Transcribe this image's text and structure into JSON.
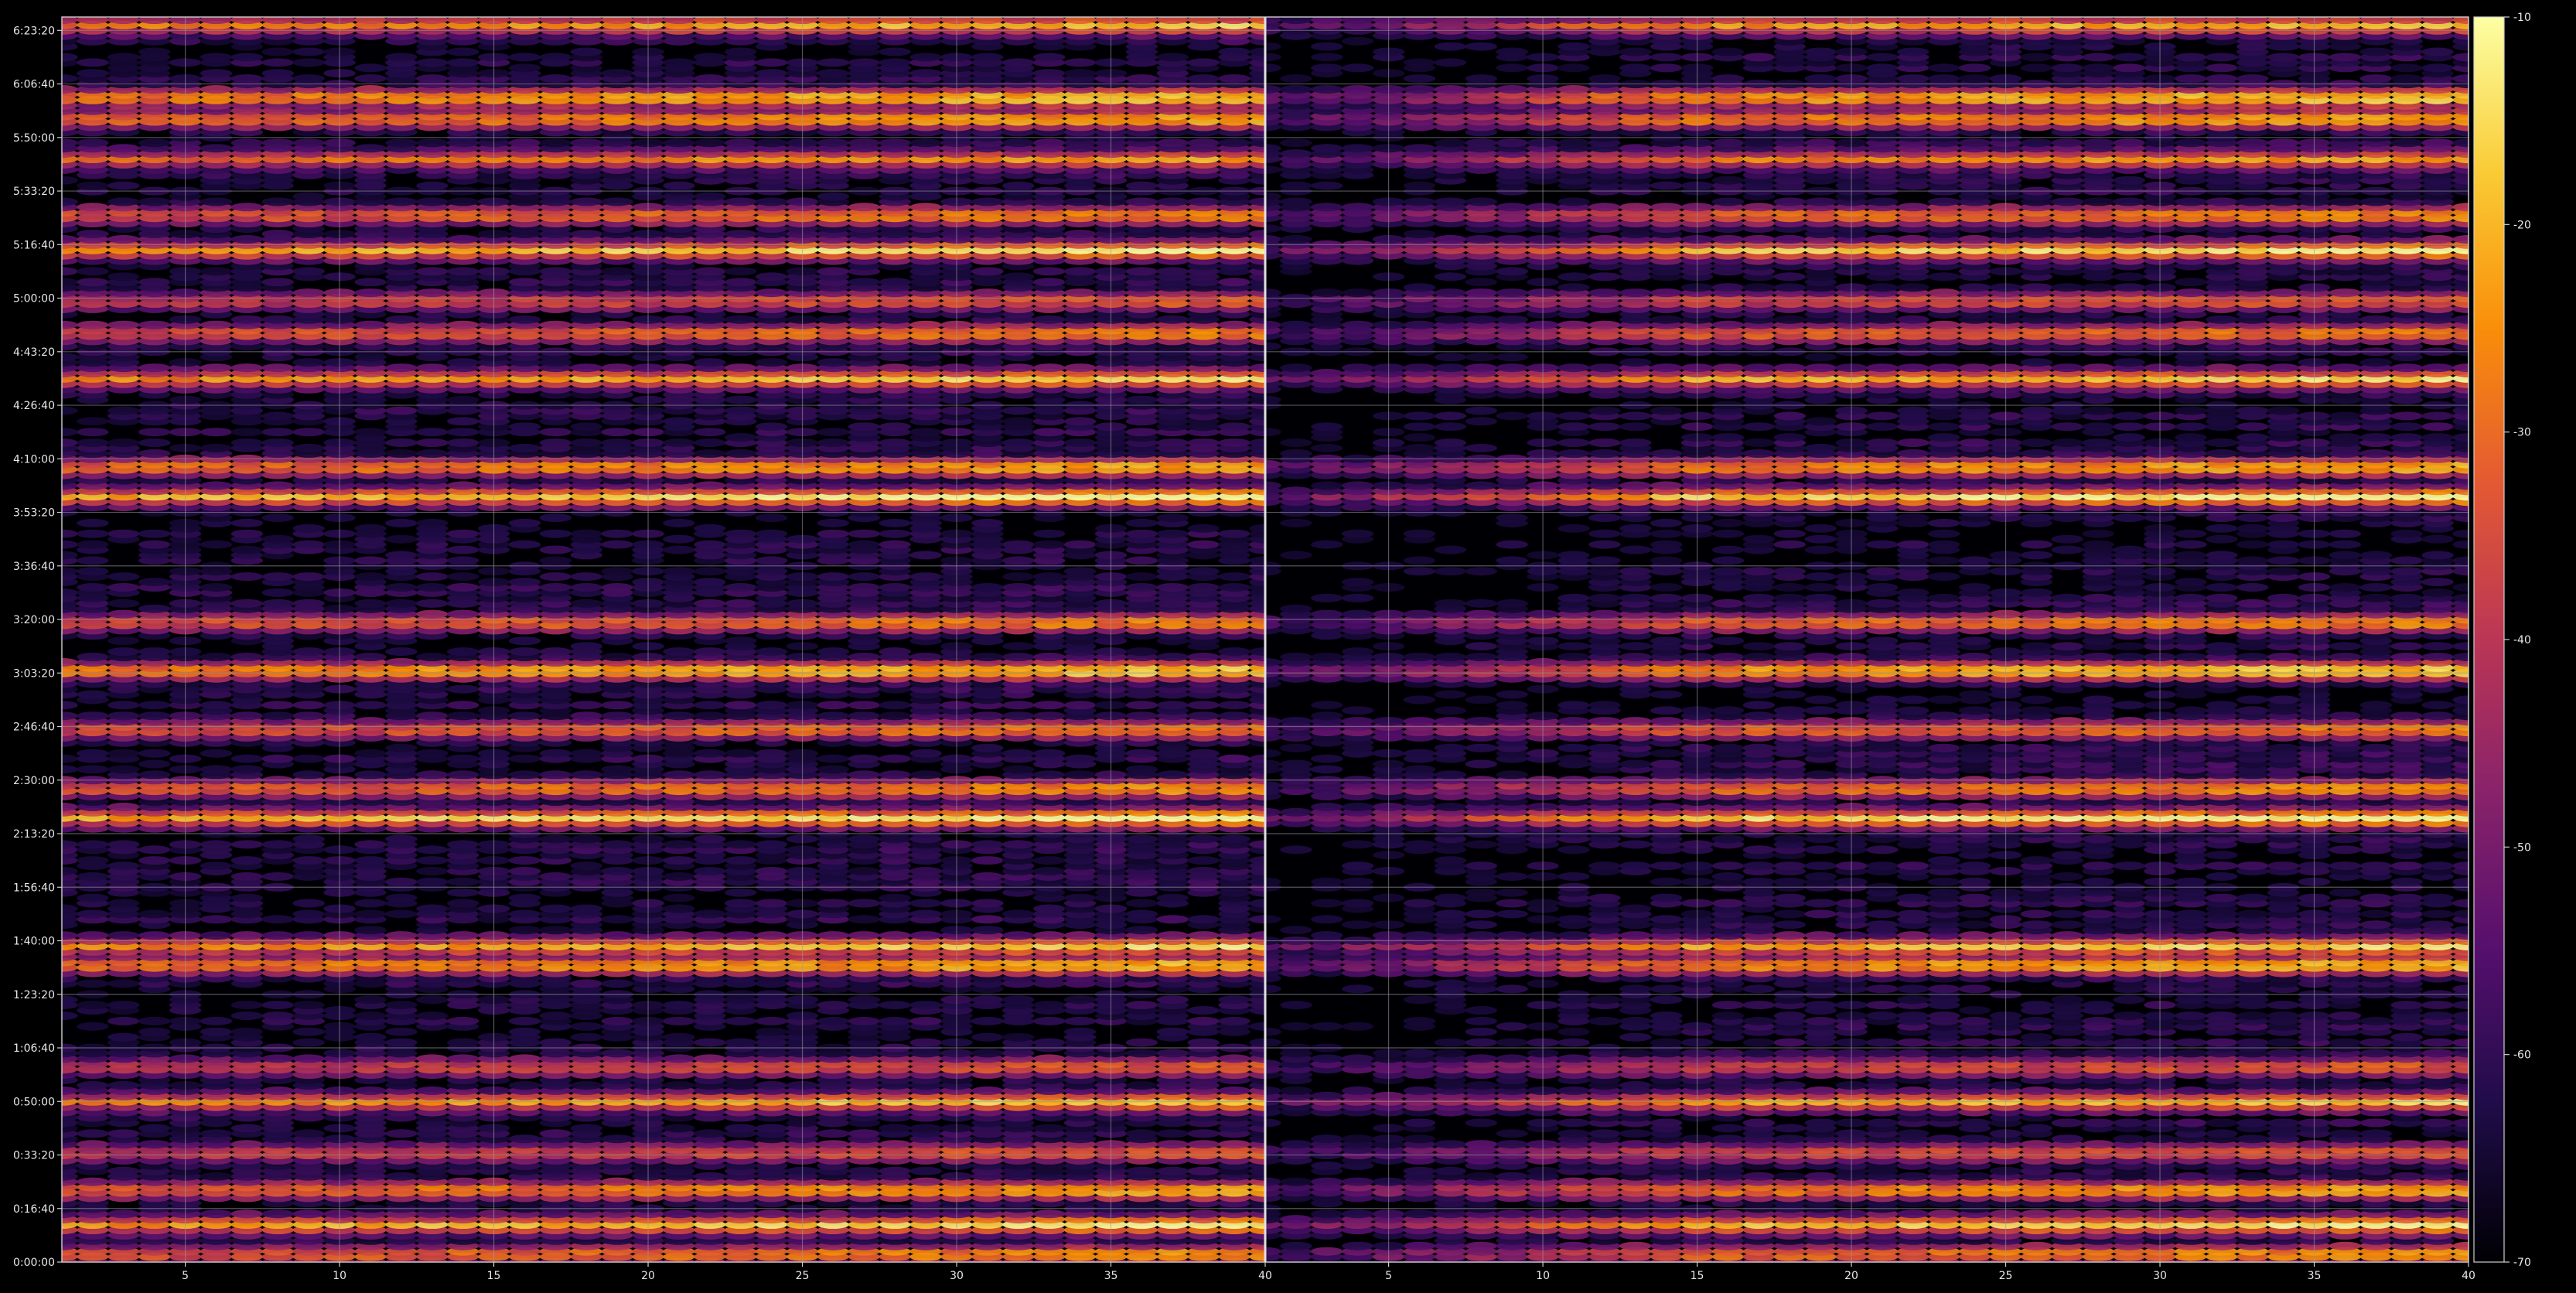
{
  "chart_data": {
    "type": "heatmap",
    "title": "",
    "xlabel": "",
    "ylabel": "",
    "panels": [
      {
        "name": "",
        "x_tick_labels": [
          "5",
          "10",
          "15",
          "20",
          "25",
          "30",
          "35",
          "40"
        ],
        "xlim": [
          1,
          40
        ]
      },
      {
        "name": "",
        "x_tick_labels": [
          "5",
          "10",
          "15",
          "20",
          "25",
          "30",
          "35",
          "40"
        ],
        "xlim": [
          1,
          40
        ]
      }
    ],
    "y_tick_labels": [
      "0:00:00",
      "0:16:40",
      "0:33:20",
      "0:50:00",
      "1:06:40",
      "1:23:20",
      "1:40:00",
      "1:56:40",
      "2:13:20",
      "2:30:00",
      "2:46:40",
      "3:03:20",
      "3:20:00",
      "3:36:40",
      "3:53:20",
      "4:10:00",
      "4:26:40",
      "4:43:20",
      "5:00:00",
      "5:16:40",
      "5:33:20",
      "5:50:00",
      "6:06:40",
      "6:23:20"
    ],
    "y_tick_seconds": [
      0,
      1000,
      2000,
      3000,
      4000,
      5000,
      6000,
      7000,
      8000,
      9000,
      10000,
      11000,
      12000,
      13000,
      14000,
      15000,
      16000,
      17000,
      18000,
      19000,
      20000,
      21000,
      22000,
      23000
    ],
    "ylim_seconds": [
      0,
      23250
    ],
    "grid": true,
    "colorbar": {
      "min": -70,
      "max": -10,
      "tick_labels": [
        "-10",
        "-20",
        "-30",
        "-40",
        "-50",
        "-60",
        "-70"
      ],
      "tick_values": [
        -10,
        -20,
        -30,
        -40,
        -50,
        -60,
        -70
      ],
      "colormap": "inferno",
      "colormap_stops": [
        "#000004",
        "#1f0c48",
        "#550f6d",
        "#88226a",
        "#ba3655",
        "#e35933",
        "#f98e09",
        "#f9cb35",
        "#fcffa4"
      ]
    },
    "bright_rows_seconds": [
      150,
      700,
      1350,
      2050,
      3000,
      3650,
      5550,
      5900,
      8300,
      8850,
      9950,
      11050,
      11950,
      14300,
      14850,
      16500,
      17350,
      17950,
      18900,
      19550,
      20600,
      21350,
      21750,
      23100
    ],
    "row_strength": [
      0.85,
      0.95,
      0.9,
      0.7,
      0.88,
      0.7,
      0.95,
      0.9,
      1.0,
      0.85,
      0.8,
      1.0,
      0.82,
      1.0,
      0.92,
      0.9,
      0.8,
      0.7,
      0.95,
      0.82,
      0.78,
      0.9,
      0.98,
      0.85
    ]
  }
}
